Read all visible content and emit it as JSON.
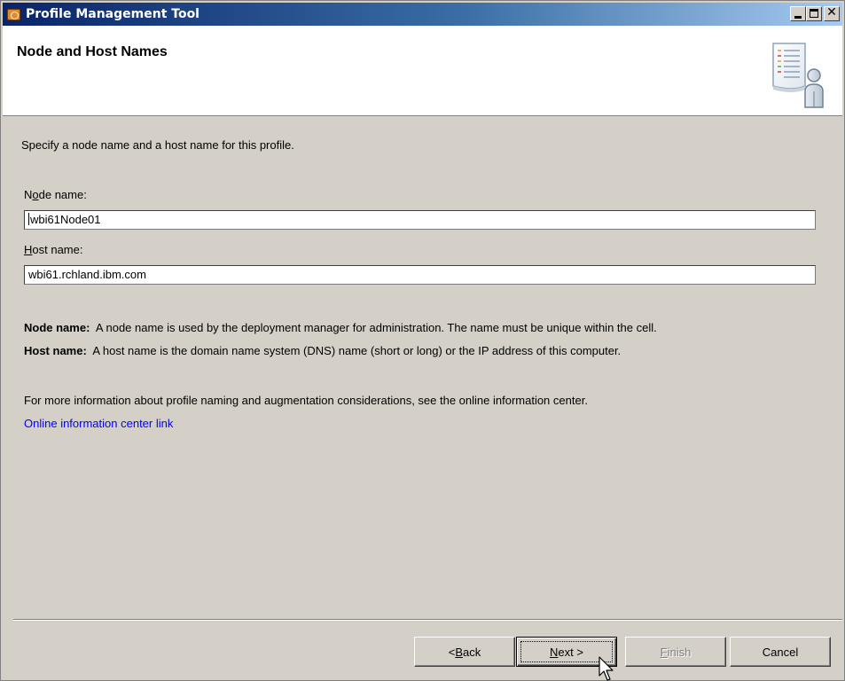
{
  "window": {
    "title": "Profile Management Tool"
  },
  "banner": {
    "title": "Node and Host Names"
  },
  "content": {
    "intro": "Specify a node name and a host name for this profile.",
    "node_label_mnemonic_pre": "N",
    "node_label_mnemonic": "o",
    "node_label_rest": "de name:",
    "node_value": "wbi61Node01",
    "host_label_mnemonic": "H",
    "host_label_rest": "ost name:",
    "host_value": "wbi61.rchland.ibm.com",
    "node_desc_term": "Node name:",
    "node_desc_text": "A node name is used by the deployment manager for administration. The name must be unique within the cell.",
    "host_desc_term": "Host name:",
    "host_desc_text": "A host name is the domain name system (DNS) name (short or long) or the IP address of this computer.",
    "more_info": "For more information about profile naming and augmentation considerations, see the online information center.",
    "link": "Online information center link"
  },
  "buttons": {
    "back_pre": "< ",
    "back_mnemonic": "B",
    "back_rest": "ack",
    "next_mnemonic": "N",
    "next_rest": "ext >",
    "finish_mnemonic": "F",
    "finish_rest": "inish",
    "cancel": "Cancel"
  },
  "icons": {
    "app": "profile-tool-icon",
    "banner": "profile-document-user-icon"
  },
  "colors": {
    "titlebar_start": "#0a246a",
    "titlebar_end": "#a6caf0",
    "link": "#0000ff",
    "dialog_bg": "#d4d0c8"
  }
}
